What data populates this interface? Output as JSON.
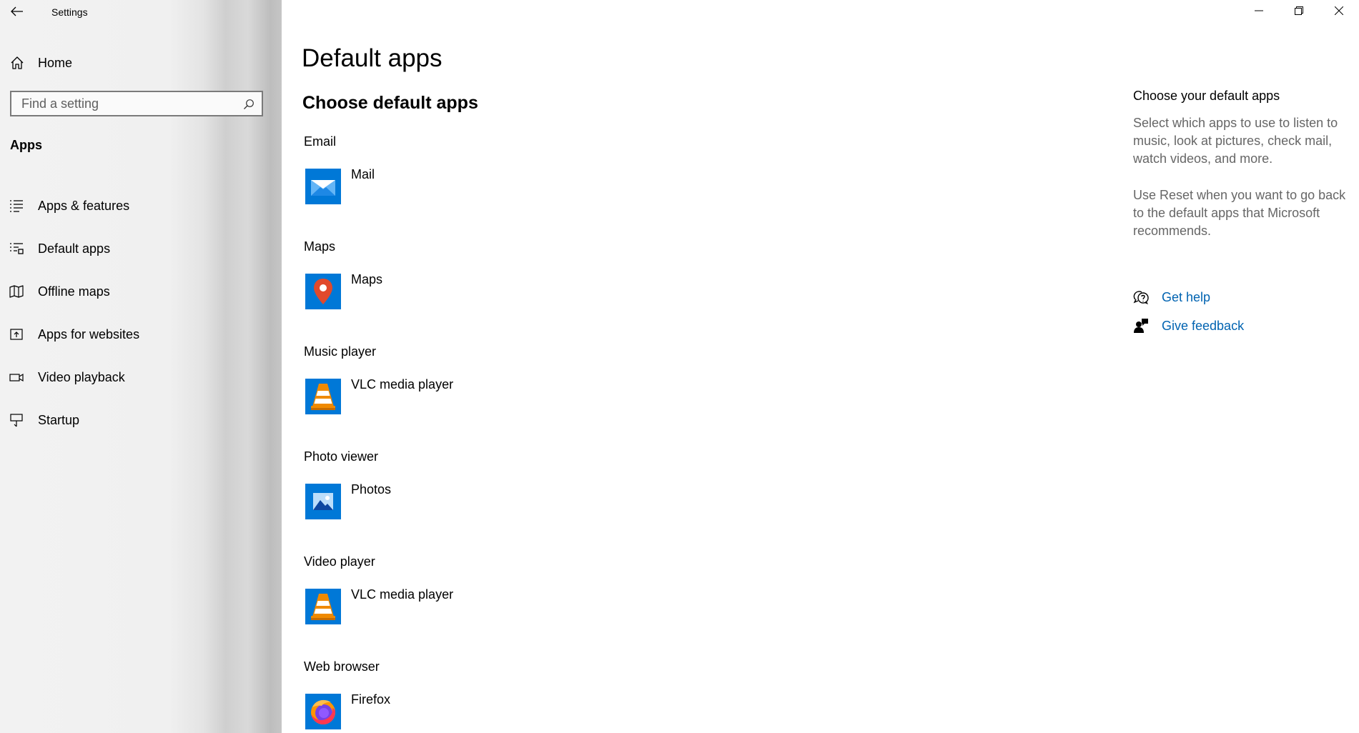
{
  "window": {
    "title": "Settings",
    "controls": [
      "minimize",
      "restore",
      "close"
    ]
  },
  "sidebar": {
    "home_label": "Home",
    "search_placeholder": "Find a setting",
    "section_title": "Apps",
    "items": [
      {
        "label": "Apps & features",
        "icon": "list-icon"
      },
      {
        "label": "Default apps",
        "icon": "default-apps-icon"
      },
      {
        "label": "Offline maps",
        "icon": "map-icon"
      },
      {
        "label": "Apps for websites",
        "icon": "open-link-icon"
      },
      {
        "label": "Video playback",
        "icon": "video-icon"
      },
      {
        "label": "Startup",
        "icon": "startup-icon"
      }
    ]
  },
  "main": {
    "title": "Default apps",
    "subtitle": "Choose default apps",
    "categories": [
      {
        "label": "Email",
        "app": "Mail",
        "icon": "mail-icon"
      },
      {
        "label": "Maps",
        "app": "Maps",
        "icon": "maps-pin-icon"
      },
      {
        "label": "Music player",
        "app": "VLC media player",
        "icon": "vlc-icon"
      },
      {
        "label": "Photo viewer",
        "app": "Photos",
        "icon": "photos-icon"
      },
      {
        "label": "Video player",
        "app": "VLC media player",
        "icon": "vlc-icon"
      },
      {
        "label": "Web browser",
        "app": "Firefox",
        "icon": "firefox-icon"
      }
    ]
  },
  "info": {
    "heading": "Choose your default apps",
    "paragraph1": "Select which apps to use to listen to music, look at pictures, check mail, watch videos, and more.",
    "paragraph2": "Use Reset when you want to go back to the default apps that Microsoft recommends.",
    "get_help": "Get help",
    "give_feedback": "Give feedback"
  },
  "colors": {
    "accent": "#0078d7",
    "link": "#0063b1",
    "secondary_text": "#666666",
    "vlc_orange": "#f08a00",
    "maps_red": "#e1492c"
  }
}
